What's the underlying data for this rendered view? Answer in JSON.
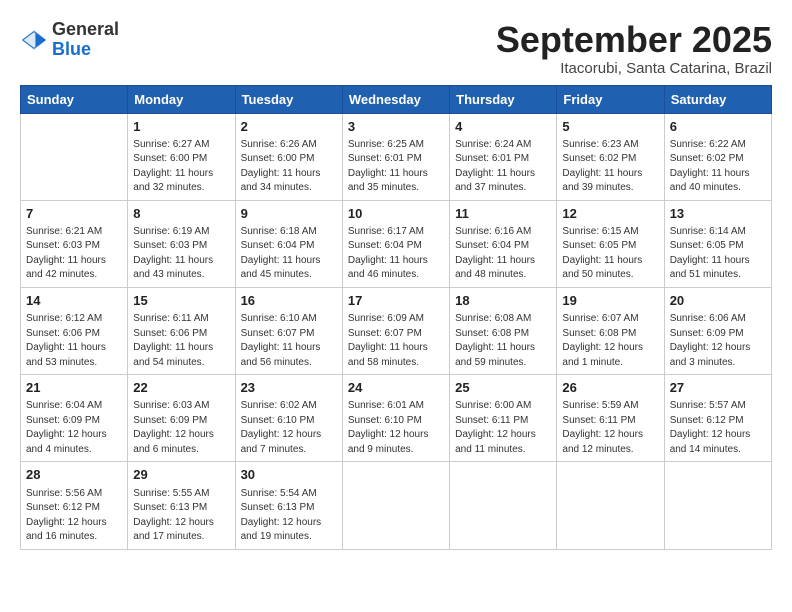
{
  "header": {
    "logo_general": "General",
    "logo_blue": "Blue",
    "month": "September 2025",
    "location": "Itacorubi, Santa Catarina, Brazil"
  },
  "days_of_week": [
    "Sunday",
    "Monday",
    "Tuesday",
    "Wednesday",
    "Thursday",
    "Friday",
    "Saturday"
  ],
  "weeks": [
    [
      {
        "day": "",
        "info": ""
      },
      {
        "day": "1",
        "info": "Sunrise: 6:27 AM\nSunset: 6:00 PM\nDaylight: 11 hours\nand 32 minutes."
      },
      {
        "day": "2",
        "info": "Sunrise: 6:26 AM\nSunset: 6:00 PM\nDaylight: 11 hours\nand 34 minutes."
      },
      {
        "day": "3",
        "info": "Sunrise: 6:25 AM\nSunset: 6:01 PM\nDaylight: 11 hours\nand 35 minutes."
      },
      {
        "day": "4",
        "info": "Sunrise: 6:24 AM\nSunset: 6:01 PM\nDaylight: 11 hours\nand 37 minutes."
      },
      {
        "day": "5",
        "info": "Sunrise: 6:23 AM\nSunset: 6:02 PM\nDaylight: 11 hours\nand 39 minutes."
      },
      {
        "day": "6",
        "info": "Sunrise: 6:22 AM\nSunset: 6:02 PM\nDaylight: 11 hours\nand 40 minutes."
      }
    ],
    [
      {
        "day": "7",
        "info": "Sunrise: 6:21 AM\nSunset: 6:03 PM\nDaylight: 11 hours\nand 42 minutes."
      },
      {
        "day": "8",
        "info": "Sunrise: 6:19 AM\nSunset: 6:03 PM\nDaylight: 11 hours\nand 43 minutes."
      },
      {
        "day": "9",
        "info": "Sunrise: 6:18 AM\nSunset: 6:04 PM\nDaylight: 11 hours\nand 45 minutes."
      },
      {
        "day": "10",
        "info": "Sunrise: 6:17 AM\nSunset: 6:04 PM\nDaylight: 11 hours\nand 46 minutes."
      },
      {
        "day": "11",
        "info": "Sunrise: 6:16 AM\nSunset: 6:04 PM\nDaylight: 11 hours\nand 48 minutes."
      },
      {
        "day": "12",
        "info": "Sunrise: 6:15 AM\nSunset: 6:05 PM\nDaylight: 11 hours\nand 50 minutes."
      },
      {
        "day": "13",
        "info": "Sunrise: 6:14 AM\nSunset: 6:05 PM\nDaylight: 11 hours\nand 51 minutes."
      }
    ],
    [
      {
        "day": "14",
        "info": "Sunrise: 6:12 AM\nSunset: 6:06 PM\nDaylight: 11 hours\nand 53 minutes."
      },
      {
        "day": "15",
        "info": "Sunrise: 6:11 AM\nSunset: 6:06 PM\nDaylight: 11 hours\nand 54 minutes."
      },
      {
        "day": "16",
        "info": "Sunrise: 6:10 AM\nSunset: 6:07 PM\nDaylight: 11 hours\nand 56 minutes."
      },
      {
        "day": "17",
        "info": "Sunrise: 6:09 AM\nSunset: 6:07 PM\nDaylight: 11 hours\nand 58 minutes."
      },
      {
        "day": "18",
        "info": "Sunrise: 6:08 AM\nSunset: 6:08 PM\nDaylight: 11 hours\nand 59 minutes."
      },
      {
        "day": "19",
        "info": "Sunrise: 6:07 AM\nSunset: 6:08 PM\nDaylight: 12 hours\nand 1 minute."
      },
      {
        "day": "20",
        "info": "Sunrise: 6:06 AM\nSunset: 6:09 PM\nDaylight: 12 hours\nand 3 minutes."
      }
    ],
    [
      {
        "day": "21",
        "info": "Sunrise: 6:04 AM\nSunset: 6:09 PM\nDaylight: 12 hours\nand 4 minutes."
      },
      {
        "day": "22",
        "info": "Sunrise: 6:03 AM\nSunset: 6:09 PM\nDaylight: 12 hours\nand 6 minutes."
      },
      {
        "day": "23",
        "info": "Sunrise: 6:02 AM\nSunset: 6:10 PM\nDaylight: 12 hours\nand 7 minutes."
      },
      {
        "day": "24",
        "info": "Sunrise: 6:01 AM\nSunset: 6:10 PM\nDaylight: 12 hours\nand 9 minutes."
      },
      {
        "day": "25",
        "info": "Sunrise: 6:00 AM\nSunset: 6:11 PM\nDaylight: 12 hours\nand 11 minutes."
      },
      {
        "day": "26",
        "info": "Sunrise: 5:59 AM\nSunset: 6:11 PM\nDaylight: 12 hours\nand 12 minutes."
      },
      {
        "day": "27",
        "info": "Sunrise: 5:57 AM\nSunset: 6:12 PM\nDaylight: 12 hours\nand 14 minutes."
      }
    ],
    [
      {
        "day": "28",
        "info": "Sunrise: 5:56 AM\nSunset: 6:12 PM\nDaylight: 12 hours\nand 16 minutes."
      },
      {
        "day": "29",
        "info": "Sunrise: 5:55 AM\nSunset: 6:13 PM\nDaylight: 12 hours\nand 17 minutes."
      },
      {
        "day": "30",
        "info": "Sunrise: 5:54 AM\nSunset: 6:13 PM\nDaylight: 12 hours\nand 19 minutes."
      },
      {
        "day": "",
        "info": ""
      },
      {
        "day": "",
        "info": ""
      },
      {
        "day": "",
        "info": ""
      },
      {
        "day": "",
        "info": ""
      }
    ]
  ]
}
